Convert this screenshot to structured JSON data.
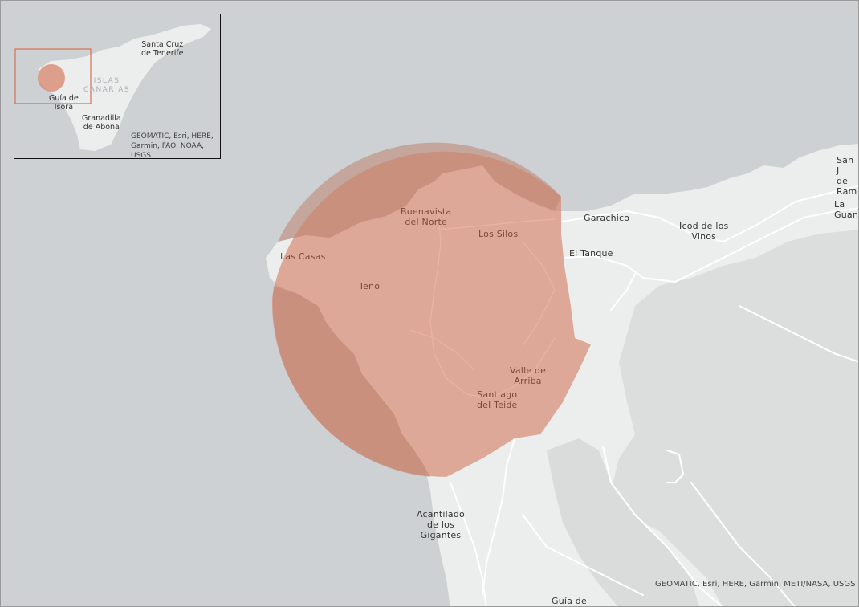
{
  "map": {
    "labels": {
      "garachico": "Garachico",
      "icod": "Icod de los\nVinos",
      "el_tanque": "El Tanque",
      "san_juan": "San J\nde\nRam",
      "la_guancha": "La\nGuanc",
      "acantilado": "Acantilado\nde los\nGigantes",
      "guia_de": "Guía de"
    },
    "area_labels": {
      "buenavista": "Buenavista\ndel Norte",
      "los_silos": "Los Silos",
      "las_casas": "Las Casas",
      "teno": "Teno",
      "valle_de_arriba": "Valle de\nArriba",
      "santiago_del_teide": "Santiago\ndel Teide"
    },
    "attribution": "GEOMATIC, Esri, HERE, Garmin, METI/NASA, USGS",
    "colors": {
      "water": "#cdd1d3",
      "land": "#eceded",
      "land_shadow": "#dfe1e1",
      "buffer_fill": "#d98a73",
      "road": "#ffffff"
    }
  },
  "inset": {
    "labels": {
      "santa_cruz": "Santa Cruz\nde Tenerife",
      "islas_canarias": "ISLAS\nCANARIAS",
      "guia_de_isora": "Guía de\nIsora",
      "granadilla": "Granadilla\nde Abona"
    },
    "attribution": "GEOMATIC, Esri, HERE,\nGarmin, FAO, NOAA, USGS",
    "colors": {
      "extent_box": "#d9714f"
    }
  }
}
